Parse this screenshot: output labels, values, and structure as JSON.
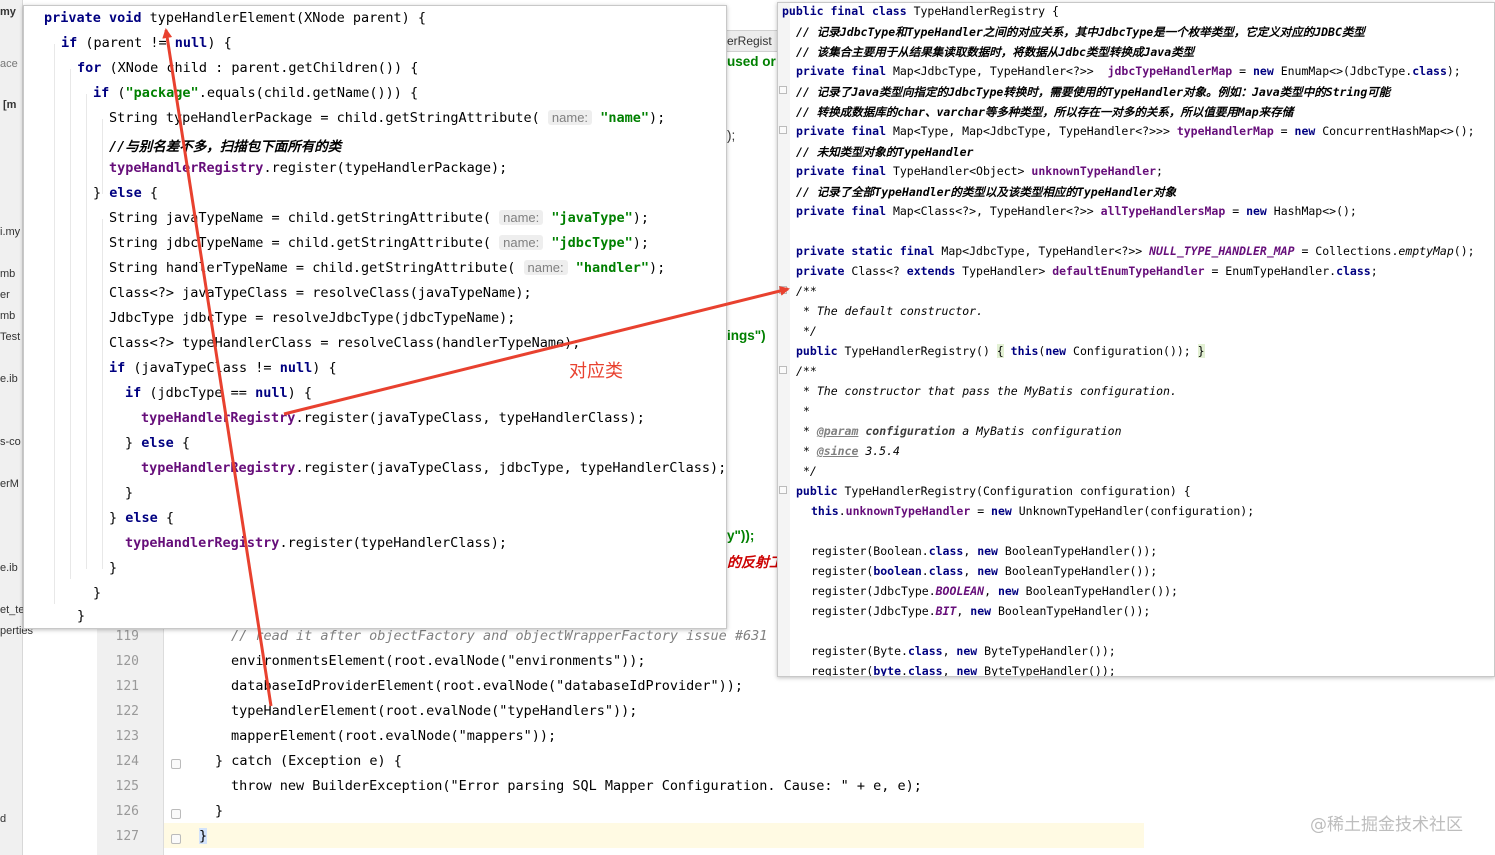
{
  "background_fragments": {
    "tab_label": "erRegist",
    "used_fragment": "used or",
    "paren_fragment": ");",
    "ings_fragment": "ings\")",
    "y_fragment": "y\"));",
    "reflect_fragment": "的反射工",
    "left_strip": [
      "my",
      "ace",
      "[m",
      "i.my",
      "mb",
      "er",
      "mb",
      "Test",
      "e.ib",
      "s-co",
      "erM",
      "e.ib",
      "et_te",
      "perties",
      "d"
    ]
  },
  "background_editor": {
    "line_numbers": [
      "119",
      "120",
      "121",
      "122",
      "123",
      "124",
      "125",
      "126",
      "127"
    ],
    "lines": [
      "// read it after objectFactory and objectWrapperFactory issue #631",
      "environmentsElement(root.evalNode(\"environments\"));",
      "databaseIdProviderElement(root.evalNode(\"databaseIdProvider\"));",
      "typeHandlerElement(root.evalNode(\"typeHandlers\"));",
      "mapperElement(root.evalNode(\"mappers\"));",
      "} catch (Exception e) {",
      "throw new BuilderException(\"Error parsing SQL Mapper Configuration. Cause: \" + e, e);",
      "}",
      "}"
    ]
  },
  "left_panel": {
    "lines": [
      "private void typeHandlerElement(XNode parent) {",
      "if (parent != null) {",
      "for (XNode child : parent.getChildren()) {",
      "if (\"package\".equals(child.getName())) {",
      "String typeHandlerPackage = child.getStringAttribute( name: \"name\");",
      "//与别名差不多，扫描包下面所有的类",
      "typeHandlerRegistry.register(typeHandlerPackage);",
      "} else {",
      "String javaTypeName = child.getStringAttribute( name: \"javaType\");",
      "String jdbcTypeName = child.getStringAttribute( name: \"jdbcType\");",
      "String handlerTypeName = child.getStringAttribute( name: \"handler\");",
      "Class<?> javaTypeClass = resolveClass(javaTypeName);",
      "JdbcType jdbcType = resolveJdbcType(jdbcTypeName);",
      "Class<?> typeHandlerClass = resolveClass(handlerTypeName);",
      "if (javaTypeClass != null) {",
      "if (jdbcType == null) {",
      "typeHandlerRegistry.register(javaTypeClass, typeHandlerClass);",
      "} else {",
      "typeHandlerRegistry.register(javaTypeClass, jdbcType, typeHandlerClass);",
      "}",
      "} else {",
      "typeHandlerRegistry.register(typeHandlerClass);",
      "}",
      "}",
      "}"
    ]
  },
  "right_panel": {
    "lines": [
      "public final class TypeHandlerRegistry {",
      "// 记录JdbcType和TypeHandler之间的对应关系，其中JdbcType是一个枚举类型，它定义对应的JDBC类型",
      "// 该集合主要用于从结果集读取数据时，将数据从Jdbc类型转换成Java类型",
      "private final Map<JdbcType, TypeHandler<?>>  jdbcTypeHandlerMap = new EnumMap<>(JdbcType.class);",
      "// 记录了Java类型向指定的JdbcType转换时，需要使用的TypeHandler对象。例如：Java类型中的String可能",
      "// 转换成数据库的char、varchar等多种类型，所以存在一对多的关系，所以值要用Map来存储",
      "private final Map<Type, Map<JdbcType, TypeHandler<?>>> typeHandlerMap = new ConcurrentHashMap<>();",
      "// 未知类型对象的TypeHandler",
      "private final TypeHandler<Object> unknownTypeHandler;",
      "// 记录了全部TypeHandler的类型以及该类型相应的TypeHandler对象",
      "private final Map<Class<?>, TypeHandler<?>> allTypeHandlersMap = new HashMap<>();",
      "private static final Map<JdbcType, TypeHandler<?>> NULL_TYPE_HANDLER_MAP = Collections.emptyMap();",
      "private Class<? extends TypeHandler> defaultEnumTypeHandler = EnumTypeHandler.class;",
      "/**",
      "* The default constructor.",
      "*/",
      "public TypeHandlerRegistry() { this(new Configuration()); }",
      "/**",
      "* The constructor that pass the MyBatis configuration.",
      "*",
      "* @param configuration a MyBatis configuration",
      "* @since 3.5.4",
      "*/",
      "public TypeHandlerRegistry(Configuration configuration) {",
      "this.unknownTypeHandler = new UnknownTypeHandler(configuration);",
      "register(Boolean.class, new BooleanTypeHandler());",
      "register(boolean.class, new BooleanTypeHandler());",
      "register(JdbcType.BOOLEAN, new BooleanTypeHandler());",
      "register(JdbcType.BIT, new BooleanTypeHandler());",
      "register(Byte.class, new ByteTypeHandler());",
      "register(byte.class, new ByteTypeHandler());"
    ]
  },
  "annotation": {
    "text": "对应类",
    "color": "#e8412f"
  },
  "watermark": {
    "text": "@稀土掘金技术社区"
  },
  "colors": {
    "keyword": "#000080",
    "string": "#008000",
    "field": "#660e7a",
    "comment": "#808080",
    "chinese_comment": "#cc0000",
    "arrow": "#e8412f"
  }
}
